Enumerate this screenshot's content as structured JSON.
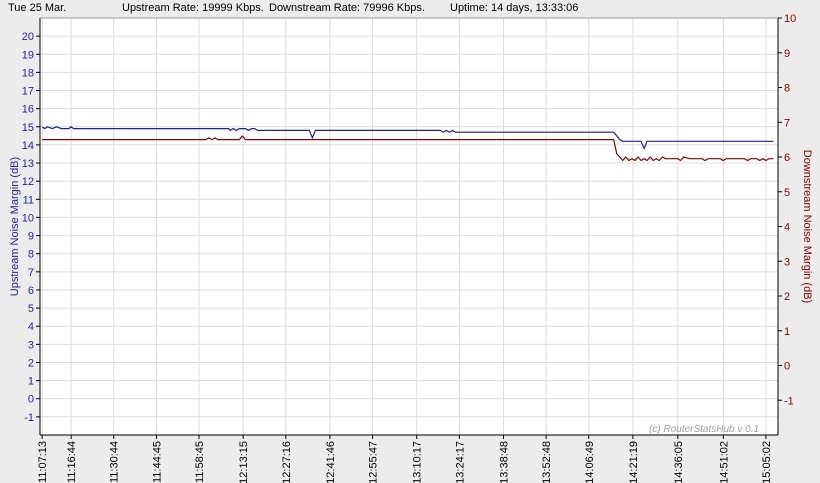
{
  "status": {
    "date": "Tue 25 Mar.",
    "upstream_rate": "Upstream Rate: 19999 Kbps.",
    "downstream_rate": "Downstream Rate: 79996 Kbps.",
    "uptime": "Uptime: 14 days, 13:33:06"
  },
  "watermark": "(c) RouterStatsHub v 0.1",
  "colors": {
    "upstream": "#1f1f9a",
    "downstream": "#8b0000",
    "plot_bg": "#ffffff",
    "grid": "#dcdcdc"
  },
  "chart_data": {
    "type": "line",
    "grid": true,
    "x_tick_labels": [
      "11:07:13",
      "11:16:44",
      "11:30:44",
      "11:44:45",
      "11:58:45",
      "12:13:15",
      "12:27:16",
      "12:41:46",
      "12:55:47",
      "13:10:17",
      "13:24:17",
      "13:38:48",
      "13:52:48",
      "14:06:49",
      "14:21:19",
      "14:36:05",
      "14:51:02",
      "15:05:02"
    ],
    "xlim": [
      "11:06:30",
      "15:09:00"
    ],
    "y_left": {
      "label": "Upstream Noise Margin (dB)",
      "ylim": [
        -2,
        21
      ],
      "ticks": [
        -1,
        0,
        1,
        2,
        3,
        4,
        5,
        6,
        7,
        8,
        9,
        10,
        11,
        12,
        13,
        14,
        15,
        16,
        17,
        18,
        19,
        20
      ]
    },
    "y_right": {
      "label": "Downstream Noise Margin (dB)",
      "ylim": [
        -2,
        10
      ],
      "ticks": [
        -1,
        0,
        1,
        2,
        3,
        4,
        5,
        6,
        7,
        8,
        9,
        10
      ]
    },
    "series": [
      {
        "axis": "left",
        "points": [
          [
            "11:07:13",
            15.0
          ],
          [
            "11:08:00",
            14.9
          ],
          [
            "11:09:00",
            15.0
          ],
          [
            "11:10:30",
            14.9
          ],
          [
            "11:12:00",
            15.0
          ],
          [
            "11:13:30",
            14.9
          ],
          [
            "11:16:00",
            14.9
          ],
          [
            "11:16:44",
            15.0
          ],
          [
            "11:17:30",
            14.9
          ],
          [
            "11:40:00",
            14.9
          ],
          [
            "12:00:00",
            14.9
          ],
          [
            "12:08:30",
            14.9
          ],
          [
            "12:09:00",
            14.8
          ],
          [
            "12:10:00",
            14.9
          ],
          [
            "12:11:00",
            14.8
          ],
          [
            "12:12:00",
            14.9
          ],
          [
            "12:14:00",
            14.9
          ],
          [
            "12:15:00",
            14.8
          ],
          [
            "12:16:00",
            14.9
          ],
          [
            "12:17:00",
            14.9
          ],
          [
            "12:18:00",
            14.8
          ],
          [
            "12:35:00",
            14.8
          ],
          [
            "12:36:00",
            14.4
          ],
          [
            "12:37:00",
            14.8
          ],
          [
            "12:55:00",
            14.8
          ],
          [
            "13:18:00",
            14.8
          ],
          [
            "13:19:00",
            14.7
          ],
          [
            "13:20:00",
            14.8
          ],
          [
            "13:21:00",
            14.7
          ],
          [
            "13:22:00",
            14.8
          ],
          [
            "13:23:00",
            14.7
          ],
          [
            "13:24:17",
            14.7
          ],
          [
            "14:00:00",
            14.7
          ],
          [
            "14:15:00",
            14.7
          ],
          [
            "14:16:00",
            14.5
          ],
          [
            "14:17:00",
            14.3
          ],
          [
            "14:18:00",
            14.2
          ],
          [
            "14:24:00",
            14.2
          ],
          [
            "14:25:00",
            13.8
          ],
          [
            "14:26:00",
            14.2
          ],
          [
            "15:00:00",
            14.2
          ],
          [
            "15:07:30",
            14.2
          ]
        ]
      },
      {
        "axis": "right",
        "points": [
          [
            "11:07:13",
            6.5
          ],
          [
            "12:01:00",
            6.5
          ],
          [
            "12:02:00",
            6.55
          ],
          [
            "12:03:00",
            6.5
          ],
          [
            "12:04:00",
            6.55
          ],
          [
            "12:05:00",
            6.5
          ],
          [
            "12:12:00",
            6.5
          ],
          [
            "12:13:00",
            6.6
          ],
          [
            "12:14:00",
            6.5
          ],
          [
            "14:15:00",
            6.5
          ],
          [
            "14:16:00",
            6.1
          ],
          [
            "14:17:00",
            6.0
          ],
          [
            "14:18:00",
            5.9
          ],
          [
            "14:19:00",
            6.0
          ],
          [
            "14:20:00",
            5.9
          ],
          [
            "14:21:00",
            5.95
          ],
          [
            "14:22:00",
            5.9
          ],
          [
            "14:23:00",
            6.0
          ],
          [
            "14:24:00",
            5.9
          ],
          [
            "14:25:00",
            5.95
          ],
          [
            "14:26:00",
            5.9
          ],
          [
            "14:27:00",
            6.0
          ],
          [
            "14:28:00",
            5.9
          ],
          [
            "14:29:00",
            5.95
          ],
          [
            "14:30:00",
            5.9
          ],
          [
            "14:31:00",
            6.0
          ],
          [
            "14:32:00",
            5.95
          ],
          [
            "14:36:00",
            5.95
          ],
          [
            "14:37:00",
            5.9
          ],
          [
            "14:38:00",
            6.0
          ],
          [
            "14:40:00",
            5.95
          ],
          [
            "14:44:00",
            5.95
          ],
          [
            "14:45:00",
            5.9
          ],
          [
            "14:46:00",
            5.95
          ],
          [
            "14:50:00",
            5.95
          ],
          [
            "14:51:00",
            5.9
          ],
          [
            "14:52:00",
            5.95
          ],
          [
            "14:58:00",
            5.95
          ],
          [
            "14:59:00",
            5.9
          ],
          [
            "15:00:00",
            5.95
          ],
          [
            "15:02:00",
            5.95
          ],
          [
            "15:03:00",
            5.9
          ],
          [
            "15:04:00",
            5.95
          ],
          [
            "15:05:00",
            5.9
          ],
          [
            "15:06:00",
            5.95
          ],
          [
            "15:07:30",
            5.95
          ]
        ]
      }
    ]
  }
}
